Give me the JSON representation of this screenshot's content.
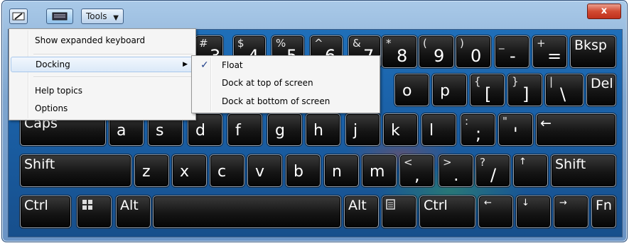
{
  "toolbar": {
    "tools_label": "Tools",
    "close_label": "x",
    "icons": [
      "handwriting-icon",
      "keyboard-icon",
      "chevron-down-icon"
    ]
  },
  "menu": {
    "items": [
      {
        "label": "Show expanded keyboard"
      },
      {
        "label": "Docking",
        "has_submenu": true
      },
      {
        "label": "Help topics"
      },
      {
        "label": "Options"
      }
    ]
  },
  "submenu": {
    "items": [
      {
        "label": "Float",
        "checked": true
      },
      {
        "label": "Dock at top of screen"
      },
      {
        "label": "Dock at bottom of screen"
      }
    ]
  },
  "keyboard": {
    "row1": [
      {
        "shift": "#",
        "main": "3"
      },
      {
        "shift": "$",
        "main": "4"
      },
      {
        "shift": "%",
        "main": "5"
      },
      {
        "shift": "^",
        "main": "6"
      },
      {
        "shift": "&",
        "main": "7"
      },
      {
        "shift": "*",
        "main": "8"
      },
      {
        "shift": "(",
        "main": "9"
      },
      {
        "shift": ")",
        "main": "0"
      },
      {
        "shift": "_",
        "main": "-"
      },
      {
        "shift": "+",
        "main": "="
      },
      {
        "main": "Bksp"
      }
    ],
    "row2": [
      "o",
      "p",
      {
        "shift": "{",
        "main": "["
      },
      {
        "shift": "}",
        "main": "]"
      },
      {
        "shift": "|",
        "main": "\\"
      },
      "Del"
    ],
    "row3": [
      "Caps",
      "a",
      "s",
      "d",
      "f",
      "g",
      "h",
      "j",
      "k",
      "l",
      {
        "shift": ":",
        "main": ";"
      },
      {
        "shift": "\"",
        "main": "'"
      },
      "←"
    ],
    "row4": [
      "Shift",
      "z",
      "x",
      "c",
      "v",
      "b",
      "n",
      "m",
      {
        "shift": "<",
        "main": ","
      },
      {
        "shift": ">",
        "main": "."
      },
      {
        "shift": "?",
        "main": "/"
      },
      "↑",
      "Shift"
    ],
    "row5": [
      "Ctrl",
      "windows-logo-icon",
      "Alt",
      "",
      "Alt",
      "menu-icon",
      "Ctrl",
      "←",
      "↓",
      "→",
      "Fn"
    ]
  }
}
